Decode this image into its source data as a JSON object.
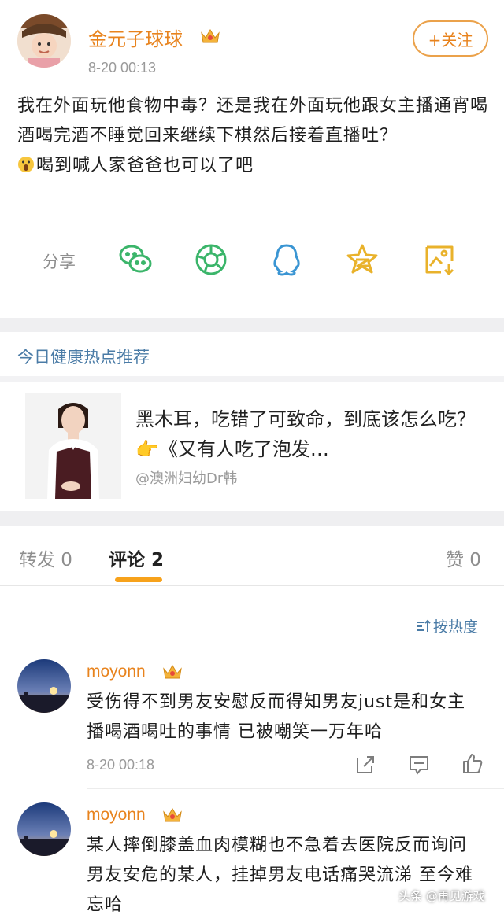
{
  "post": {
    "username": "金元子球球",
    "time": "8-20 00:13",
    "follow_label": "+关注",
    "text_line1": "我在外面玩他食物中毒？还是我在外面玩他跟女主播通宵喝酒喝完酒不睡觉回来继续下棋然后接着直播吐？",
    "text_line2": "喝到喊人家爸爸也可以了吧"
  },
  "share": {
    "label": "分享",
    "icons": [
      "wechat-icon",
      "moments-icon",
      "qq-icon",
      "qzone-icon",
      "save-image-icon"
    ]
  },
  "health": {
    "header": "今日健康热点推荐",
    "title": "黑木耳，吃错了可致命，到底该怎么吃？👉《又有人吃了泡发…",
    "source": "@澳洲妇幼Dr韩"
  },
  "tabs": {
    "repost": "转发 0",
    "comments": "评论 2",
    "likes": "赞 0"
  },
  "sort_label": "按热度",
  "comments": [
    {
      "username": "moyonn",
      "text": "受伤得不到男友安慰反而得知男友just是和女主播喝酒喝吐的事情 已被嘲笑一万年哈",
      "time": "8-20 00:18"
    },
    {
      "username": "moyonn",
      "text": "某人摔倒膝盖血肉模糊也不急着去医院反而询问男友安危的某人，挂掉男友电话痛哭流涕 至今难忘哈"
    }
  ],
  "watermark": "头条 @再见游戏",
  "colors": {
    "accent_orange": "#e8831d",
    "link_blue": "#4a7ba6",
    "green_icon": "#3bb56a",
    "gold_icon": "#e9b22b"
  }
}
